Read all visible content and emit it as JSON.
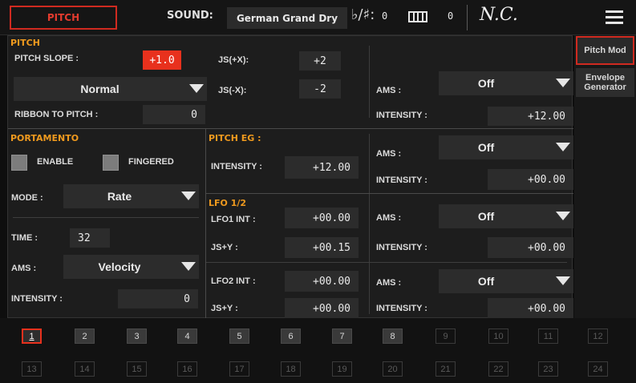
{
  "header": {
    "title": "PITCH",
    "sound_label": "SOUND:",
    "sound_name": "German Grand Dry",
    "transpose_symbol": "♭/♯:",
    "transpose_value": "0",
    "kbd_value": "0",
    "chord": "N.C.",
    "menu_icon": "hamburger-menu-icon"
  },
  "side_tabs": [
    {
      "label": "Pitch Mod",
      "active": true
    },
    {
      "label": "Envelope Generator",
      "active": false
    }
  ],
  "pitch": {
    "title": "PITCH",
    "slope_label": "PITCH SLOPE :",
    "slope_value": "+1.0",
    "mode_value": "Normal",
    "js_plus_x_label": "JS(+X):",
    "js_plus_x_value": "+2",
    "js_minus_x_label": "JS(-X):",
    "js_minus_x_value": "-2",
    "ribbon_label": "RIBBON TO PITCH :",
    "ribbon_value": "0",
    "ams_label": "AMS :",
    "ams_value": "Off",
    "intensity_label": "INTENSITY :",
    "intensity_value": "+12.00"
  },
  "portamento": {
    "title": "PORTAMENTO",
    "enable_label": "ENABLE",
    "fingered_label": "FINGERED",
    "mode_label": "MODE :",
    "mode_value": "Rate",
    "time_label": "TIME :",
    "time_value": "32",
    "ams_label": "AMS :",
    "ams_value": "Velocity",
    "intensity_label": "INTENSITY :",
    "intensity_value": "0"
  },
  "pitch_eg": {
    "title": "PITCH EG :",
    "intensity_label": "INTENSITY :",
    "intensity_value": "+12.00",
    "ams_label": "AMS :",
    "ams_value": "Off",
    "ams_intensity_label": "INTENSITY :",
    "ams_intensity_value": "+00.00"
  },
  "lfo": {
    "title": "LFO 1/2",
    "lfo1_label": "LFO1 INT :",
    "lfo1_value": "+00.00",
    "lfo1_js_label": "JS+Y :",
    "lfo1_js_value": "+00.15",
    "lfo1_ams_label": "AMS :",
    "lfo1_ams_value": "Off",
    "lfo1_int_label": "INTENSITY :",
    "lfo1_int_value": "+00.00",
    "lfo2_label": "LFO2 INT :",
    "lfo2_value": "+00.00",
    "lfo2_js_label": "JS+Y :",
    "lfo2_js_value": "+00.00",
    "lfo2_ams_label": "AMS :",
    "lfo2_ams_value": "Off",
    "lfo2_int_label": "INTENSITY :",
    "lfo2_int_value": "+00.00"
  },
  "pads_row1": [
    "1",
    "2",
    "3",
    "4",
    "5",
    "6",
    "7",
    "8",
    "9",
    "10",
    "11",
    "12"
  ],
  "pads_row2": [
    "13",
    "14",
    "15",
    "16",
    "17",
    "18",
    "19",
    "20",
    "21",
    "22",
    "23",
    "24"
  ],
  "pad_selected": "1",
  "pads_active_count": 8,
  "colors": {
    "accent_red": "#e8311d",
    "section_orange": "#f09a1e"
  }
}
